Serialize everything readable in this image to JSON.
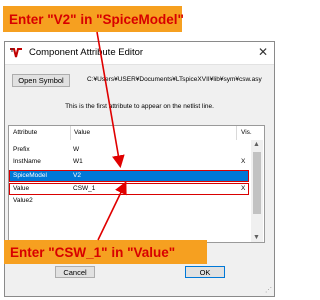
{
  "callouts": {
    "top": "Enter \"V2\" in \"SpiceModel\"",
    "bottom": "Enter \"CSW_1\" in \"Value\""
  },
  "dialog": {
    "title": "Component Attribute Editor",
    "open_symbol_label": "Open Symbol",
    "symbol_path": "C:¥Users¥USER¥Documents¥LTspiceXVII¥lib¥sym¥csw.asy",
    "info": "This is the first attribute to appear on the netlist line.",
    "columns": {
      "attribute": "Attribute",
      "value": "Value",
      "vis": "Vis."
    },
    "rows": [
      {
        "attribute": "Prefix",
        "value": "W",
        "vis": ""
      },
      {
        "attribute": "InstName",
        "value": "W1",
        "vis": "X"
      },
      {
        "attribute": "SpiceModel",
        "value": "V2",
        "vis": ""
      },
      {
        "attribute": "Value",
        "value": "CSW_1",
        "vis": "X"
      },
      {
        "attribute": "Value2",
        "value": "",
        "vis": ""
      }
    ],
    "cancel_label": "Cancel",
    "ok_label": "OK"
  },
  "colors": {
    "callout_bg": "#f6a020",
    "callout_text": "#d80000",
    "selection": "#0078d7",
    "highlight": "#d90000"
  }
}
